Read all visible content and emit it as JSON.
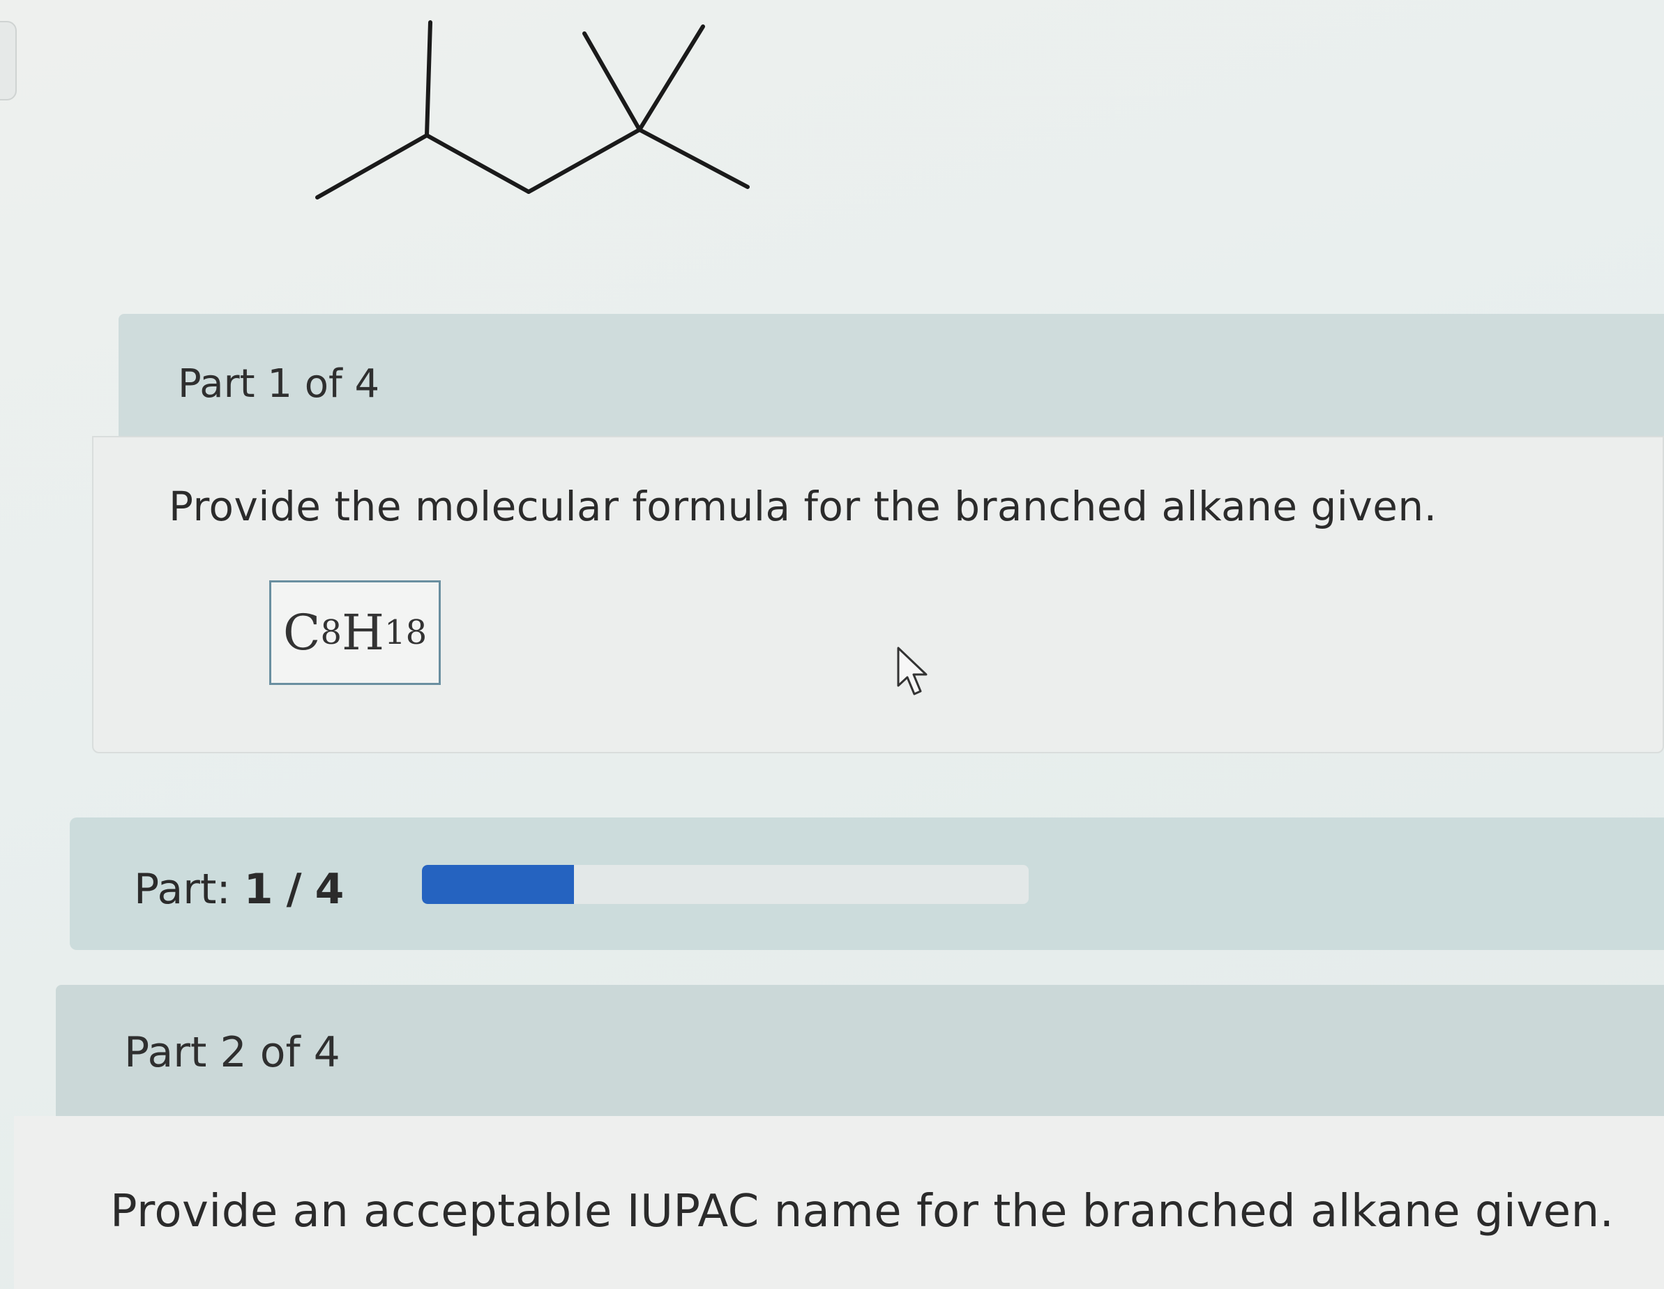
{
  "part1": {
    "title": "Part 1 of 4",
    "question": "Provide the molecular formula for the branched alkane given.",
    "formula": {
      "c": "C",
      "c_count": "8",
      "h": "H",
      "h_count": "18"
    }
  },
  "progress": {
    "label": "Part:",
    "current": "1",
    "separator": "/",
    "total": "4",
    "fraction": 0.25,
    "fill_color": "#2563c0"
  },
  "part2": {
    "title": "Part 2 of 4",
    "question": "Provide an acceptable IUPAC name for the branched alkane given."
  },
  "icons": {
    "cursor": "mouse-pointer-icon"
  }
}
